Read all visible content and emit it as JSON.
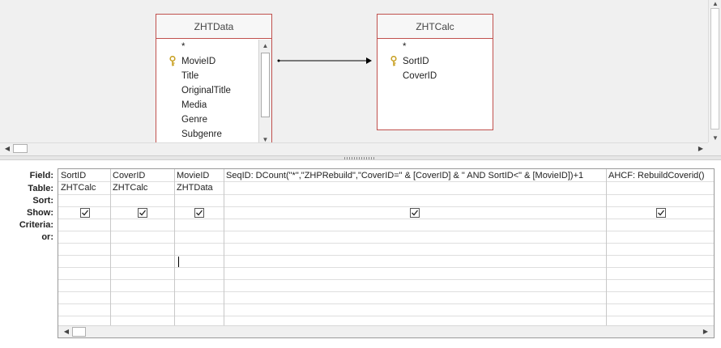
{
  "diagram": {
    "tables": [
      {
        "name": "ZHTData",
        "fields": [
          {
            "label": "*",
            "key": false
          },
          {
            "label": "MovieID",
            "key": true
          },
          {
            "label": "Title",
            "key": false
          },
          {
            "label": "OriginalTitle",
            "key": false
          },
          {
            "label": "Media",
            "key": false
          },
          {
            "label": "Genre",
            "key": false
          },
          {
            "label": "Subgenre",
            "key": false
          }
        ]
      },
      {
        "name": "ZHTCalc",
        "fields": [
          {
            "label": "*",
            "key": false
          },
          {
            "label": "SortID",
            "key": true
          },
          {
            "label": "CoverID",
            "key": false
          }
        ]
      }
    ],
    "join": {
      "from": "ZHTData.MovieID",
      "to": "ZHTCalc.SortID"
    }
  },
  "qbe": {
    "row_labels": [
      "Field:",
      "Table:",
      "Sort:",
      "Show:",
      "Criteria:",
      "or:"
    ],
    "columns": [
      {
        "field": "SortID",
        "table": "ZHTCalc",
        "sort": "",
        "show": true
      },
      {
        "field": "CoverID",
        "table": "ZHTCalc",
        "sort": "",
        "show": true
      },
      {
        "field": "MovieID",
        "table": "ZHTData",
        "sort": "",
        "show": true
      },
      {
        "field": "SeqID: DCount(\"*\",\"ZHPRebuild\",\"CoverID=\" & [CoverID] & \" AND SortID<\" & [MovieID])+1",
        "table": "",
        "sort": "",
        "show": true
      },
      {
        "field": "AHCF: RebuildCoverid()",
        "table": "",
        "sort": "",
        "show": true
      }
    ]
  },
  "icons": {
    "primary_key": "key-icon",
    "scroll_up": "arrow-up-icon",
    "scroll_down": "arrow-down-icon",
    "scroll_left": "arrow-left-icon",
    "scroll_right": "arrow-right-icon"
  },
  "colors": {
    "table_border": "#c0504d",
    "diagram_background": "#f0f0f0",
    "key_icon": "#c9a227"
  }
}
